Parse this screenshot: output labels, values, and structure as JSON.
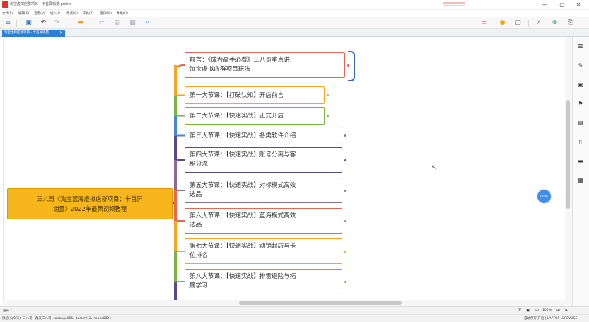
{
  "window": {
    "title": "淘宝虚拟店群项目 - 卡首屏销量.pmind",
    "minimize_icon": "—",
    "maximize_icon": "▢",
    "close_icon": "✕"
  },
  "menu": [
    "文件(F)",
    "编辑(E)",
    "查看(V)",
    "插入(I)",
    "格式(O)",
    "工具(T)",
    "窗口(W)",
    "帮助(H)"
  ],
  "tab": {
    "label": "淘宝虚拟店群项目 - 卡首屏销量",
    "close_icon": "✕"
  },
  "mindmap": {
    "root": {
      "line1": "三八哥《淘宝蓝海虚拟店群项目：卡首屏",
      "line2": "销量》2022年最新视频教程",
      "color": "#f7b61c"
    },
    "nodes": [
      {
        "line1": "前言：《成为高手必看》三八哥重点讲,",
        "line2": "淘宝虚拟店群项目玩法",
        "color": "#e8655a"
      },
      {
        "line1": "第一大节课：【打破认知】开店前言",
        "line2": "",
        "color": "#f5a623"
      },
      {
        "line1": "第二大节课：【快速实战】正式开店",
        "line2": "",
        "color": "#7cb342"
      },
      {
        "line1": "第三大节课：【快速实战】各类软件介绍",
        "line2": "",
        "color": "#4a86cf"
      },
      {
        "line1": "第四大节课：【快速实战】账号分离与客",
        "line2": "服分流",
        "color": "#5b4a8b"
      },
      {
        "line1": "第五大节课：【快速实战】对标模式高效",
        "line2": "选品",
        "color": "#8a6a92"
      },
      {
        "line1": "第六大节课：【快速实战】蓝海模式高效",
        "line2": "选品",
        "color": "#e8655a"
      },
      {
        "line1": "第七大节课：【快速实战】动销起店与卡",
        "line2": "位排名",
        "color": "#f5a623"
      },
      {
        "line1": "第八大节课：【快速实战】排雷避险与拓",
        "line2": "展学习",
        "color": "#7cb342"
      }
    ],
    "zoom_badge": "0000"
  },
  "status": {
    "left": "画布 1",
    "zoom": "100%",
    "footer_left": "微信(公众号): 三八哥，群友三八哥: sanbage005、taoke912、taoke8821",
    "footer_right": "自动保存  开启  |  LAPTOP-LEREVOSE"
  }
}
